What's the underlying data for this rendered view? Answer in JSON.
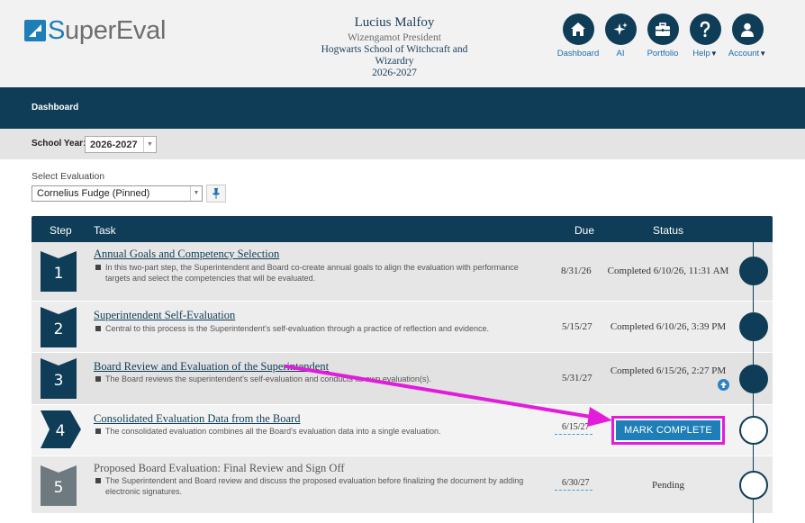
{
  "logo": {
    "text_s": "S",
    "text_rest": "uperEval"
  },
  "user": {
    "name": "Lucius Malfoy",
    "role": "Wizengamot President",
    "school": "Hogwarts School of Witchcraft and Wizardry",
    "year": "2026-2027"
  },
  "nav": [
    {
      "label": "Dashboard",
      "icon": "home-icon",
      "caret": ""
    },
    {
      "label": "AI",
      "icon": "sparkle-icon",
      "caret": ""
    },
    {
      "label": "Portfolio",
      "icon": "briefcase-icon",
      "caret": ""
    },
    {
      "label": "Help",
      "icon": "question-icon",
      "caret": "▼"
    },
    {
      "label": "Account",
      "icon": "person-icon",
      "caret": "▼"
    }
  ],
  "breadcrumb": "Dashboard",
  "school_year": {
    "label": "School Year:",
    "value": "2026-2027"
  },
  "select_eval": {
    "label": "Select Evaluation",
    "value": "Cornelius Fudge (Pinned)"
  },
  "table": {
    "headers": {
      "step": "Step",
      "task": "Task",
      "due": "Due",
      "status": "Status"
    },
    "rows": [
      {
        "step": "1",
        "title": "Annual Goals and Competency Selection",
        "desc": "In this two-part step, the Superintendent and Board co-create annual goals to align the evaluation with performance targets and select the competencies that will be evaluated.",
        "due": "8/31/26",
        "status": "Completed 6/10/26, 11:31 AM"
      },
      {
        "step": "2",
        "title": "Superintendent Self-Evaluation",
        "desc": "Central to this process is the Superintendent's self-evaluation through a practice of reflection and evidence.",
        "due": "5/15/27",
        "status": "Completed 6/10/26, 3:39 PM"
      },
      {
        "step": "3",
        "title": "Board Review and Evaluation of the Superintendent",
        "desc": "The Board reviews the superintendent's self-evaluation and conducts its own evaluation(s).",
        "due": "5/31/27",
        "status": "Completed 6/15/26, 2:27 PM"
      },
      {
        "step": "4",
        "title": "Consolidated Evaluation Data from the Board",
        "desc": "The consolidated evaluation combines all the Board's evaluation data into a single evaluation.",
        "due": "6/15/27",
        "status": "",
        "button": "MARK COMPLETE"
      },
      {
        "step": "5",
        "title": "Proposed Board Evaluation: Final Review and Sign Off",
        "desc": "The Superintendent and Board review and discuss the proposed evaluation before finalizing the document by adding electronic signatures.",
        "due": "6/30/27",
        "status": "Pending"
      }
    ]
  },
  "colors": {
    "navy": "#0f3d57",
    "brand_blue": "#1e7fb8",
    "annotation_magenta": "#e21cdb",
    "step_future_gray": "#6e7a80"
  }
}
